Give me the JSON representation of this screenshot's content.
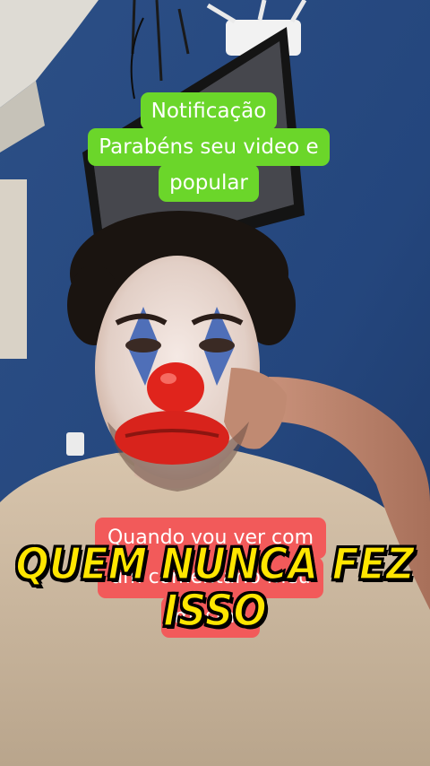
{
  "notification_caption": {
    "lines": [
      "Notificação",
      "Parabéns seu video e",
      "popular"
    ],
    "bg_color": "#6bd62a"
  },
  "comment_caption": {
    "lines": [
      "Quando vou ver com",
      "um comentário meu",
      "mesmo"
    ],
    "bg_color": "#f25a5a"
  },
  "title_overlay": {
    "lines": [
      "QUEM NUNCA FEZ",
      "ISSO"
    ],
    "color": "#ffe600"
  }
}
